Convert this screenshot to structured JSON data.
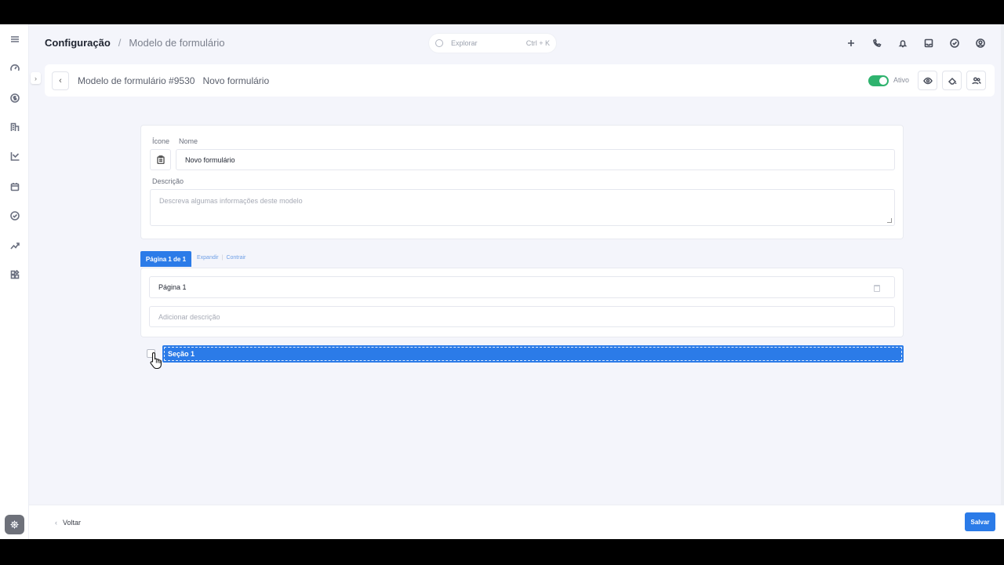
{
  "breadcrumb": {
    "root": "Configuração",
    "separator": "/",
    "current": "Modelo de formulário"
  },
  "search": {
    "placeholder": "Explorar",
    "shortcut": "Ctrl + K"
  },
  "header": {
    "title": "Modelo de formulário #9530",
    "subtitle": "Novo formulário",
    "status_label": "Ativo",
    "status_active": true
  },
  "form": {
    "icon_label": "Ícone",
    "name_label": "Nome",
    "name_value": "Novo formulário",
    "description_label": "Descrição",
    "description_placeholder": "Descreva algumas informações deste modelo"
  },
  "pages": {
    "tab_label": "Página 1 de 1",
    "expand_label": "Expandir",
    "collapse_label": "Contrair",
    "page_title": "Página 1",
    "description_placeholder": "Adicionar descrição"
  },
  "section": {
    "title": "Seção 1",
    "selected": true
  },
  "footer": {
    "back_label": "Voltar",
    "save_label": "Salvar"
  },
  "colors": {
    "accent": "#2b7be8",
    "active_toggle": "#2fb36e",
    "background": "#f4f5fb"
  },
  "icons": {
    "rail": [
      "menu-icon",
      "speedometer-icon",
      "dollar-icon",
      "building-icon",
      "chart-icon",
      "calendar-icon",
      "check-circle-icon",
      "trend-icon",
      "widgets-icon",
      "settings-icon"
    ],
    "topbar": [
      "plus-icon",
      "phone-icon",
      "bell-icon",
      "inbox-icon",
      "check-icon",
      "user-circle-icon"
    ]
  }
}
